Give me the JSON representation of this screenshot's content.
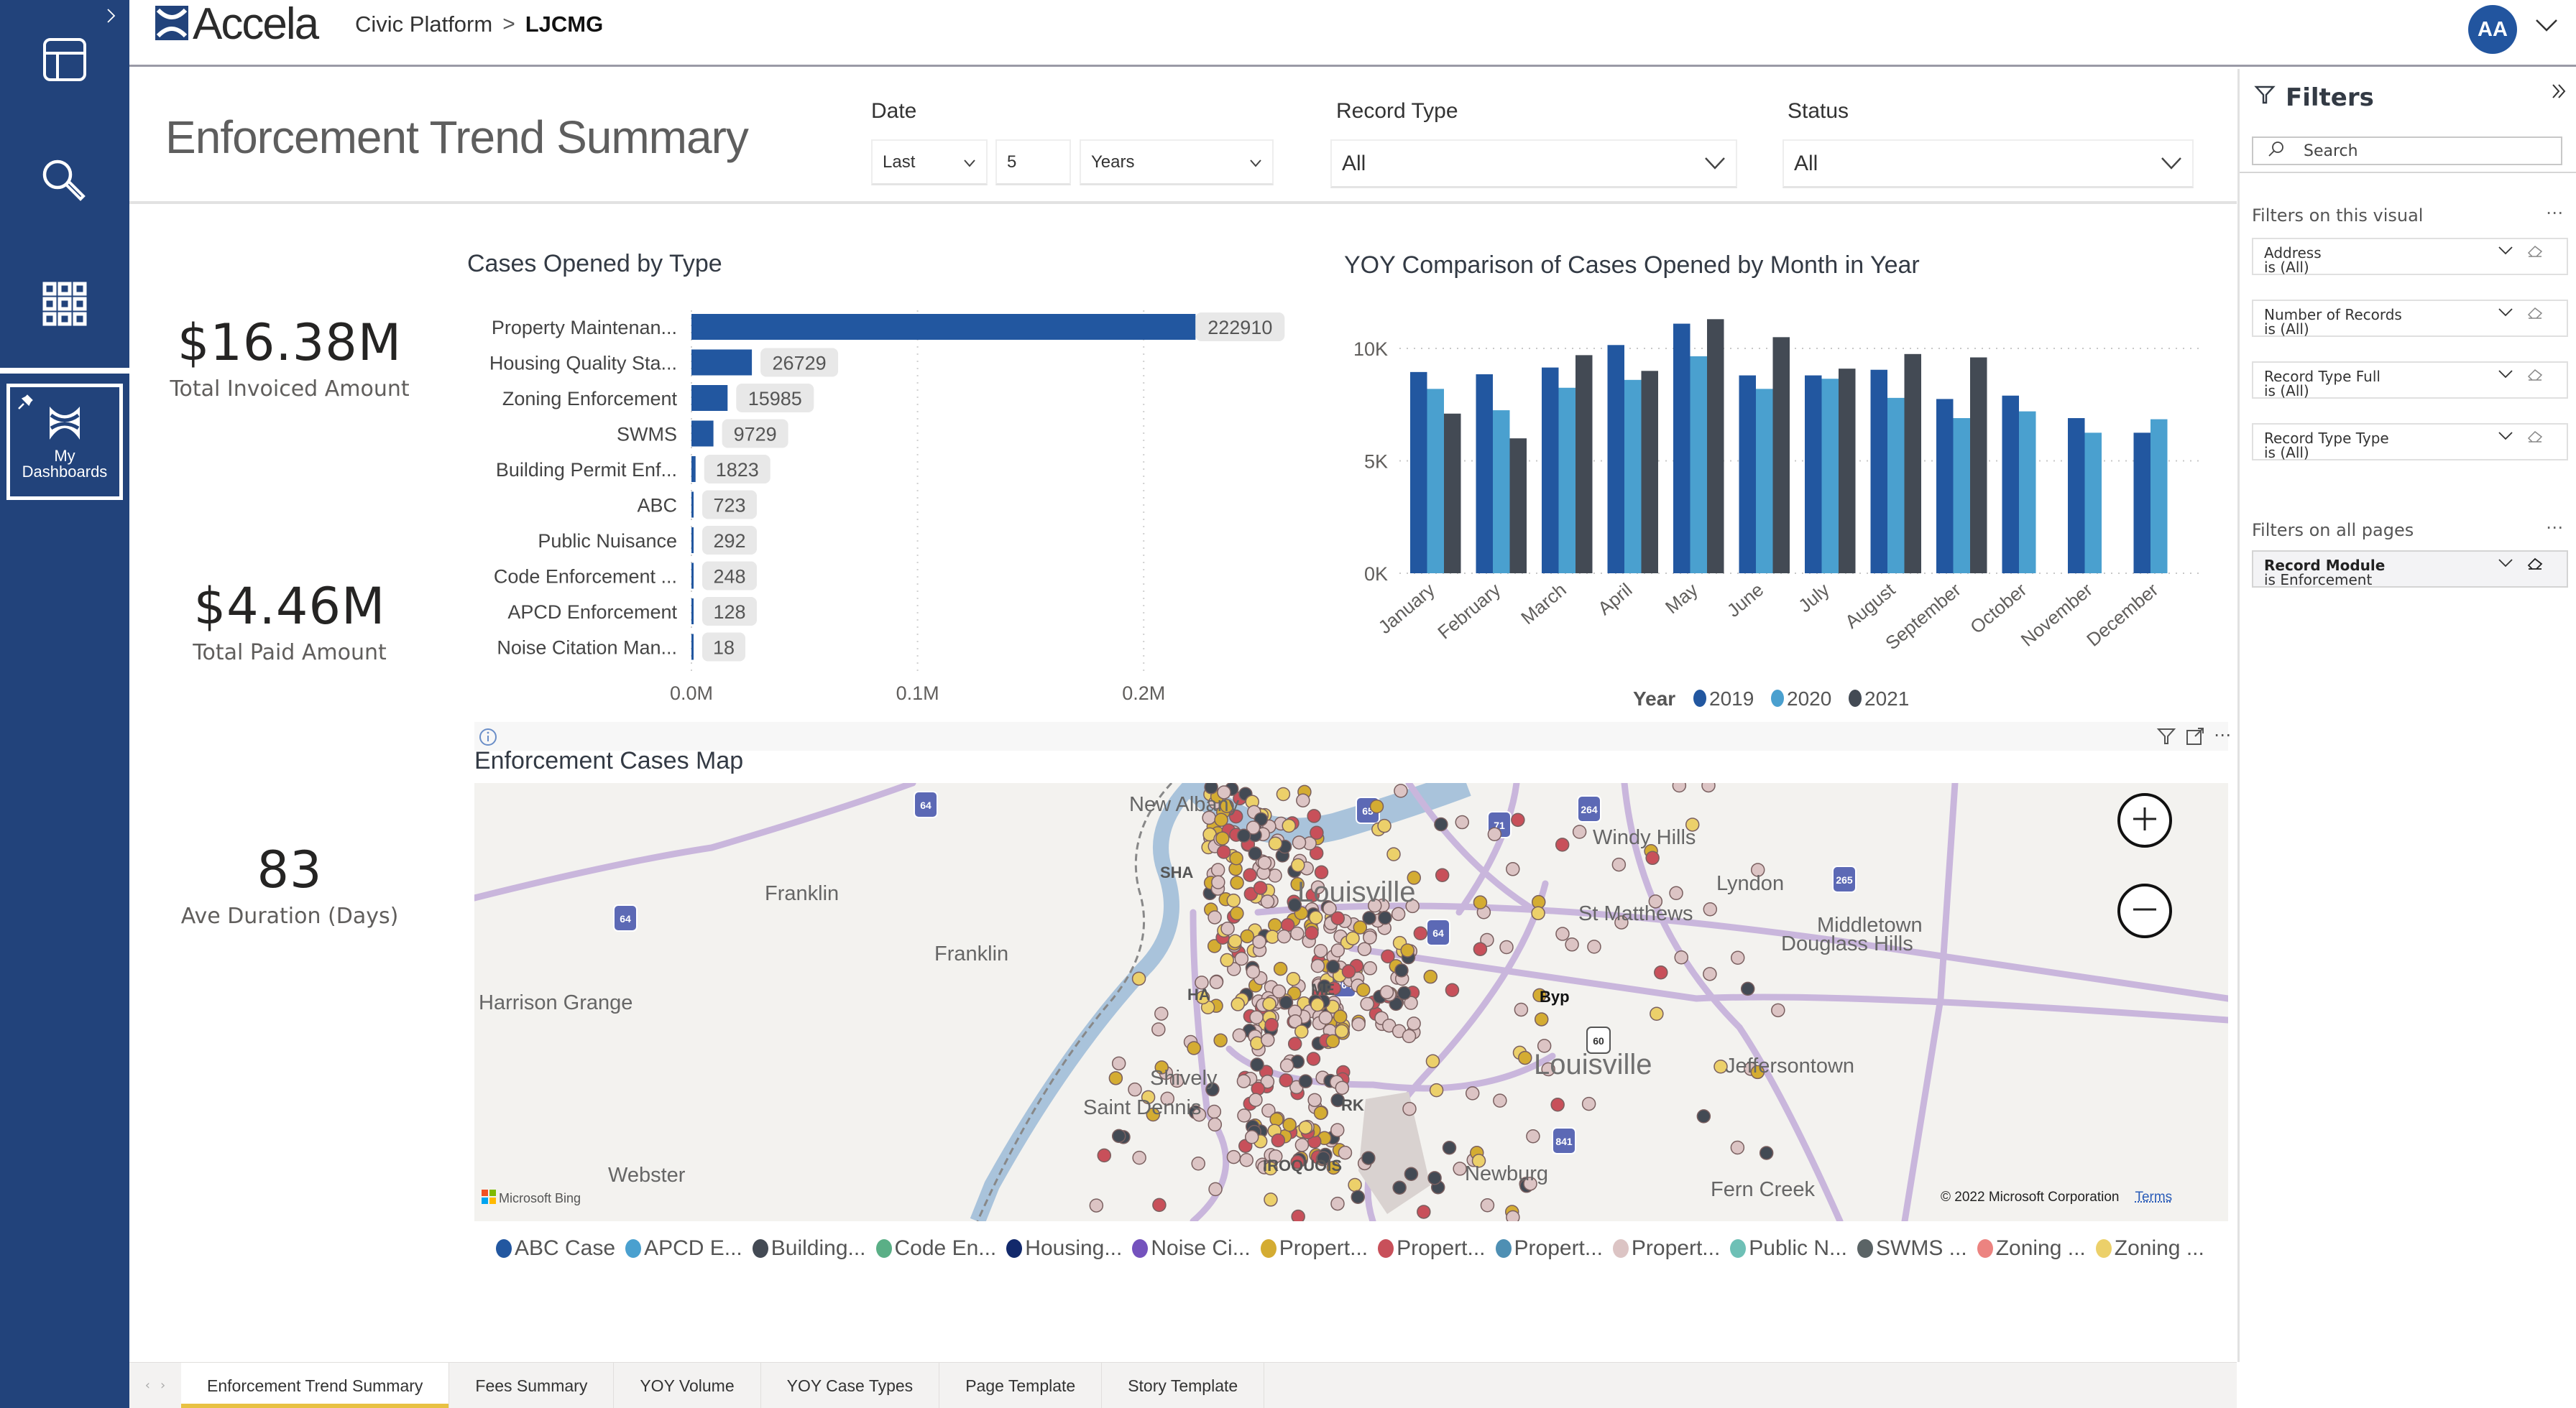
{
  "app": {
    "brand": "Accela",
    "breadcrumb": [
      "Civic Platform",
      "LJCMG"
    ],
    "breadcrumb_separator": ">",
    "user_initials": "AA",
    "brand_color": "#22437b"
  },
  "sidebar": {
    "items": [
      {
        "icon": "layout-icon",
        "label": "Layout"
      },
      {
        "icon": "search-icon",
        "label": "Search"
      },
      {
        "icon": "apps-grid-icon",
        "label": "Apps"
      }
    ],
    "dashboards_label_line1": "My",
    "dashboards_label_line2": "Dashboards"
  },
  "header": {
    "title": "Enforcement Trend Summary",
    "date": {
      "label": "Date",
      "relative": "Last",
      "count": "5",
      "unit": "Years"
    },
    "record_type": {
      "label": "Record Type",
      "value": "All"
    },
    "status": {
      "label": "Status",
      "value": "All"
    }
  },
  "kpis": [
    {
      "value": "$16.38M",
      "label": "Total Invoiced Amount"
    },
    {
      "value": "$4.46M",
      "label": "Total Paid Amount"
    },
    {
      "value": "83",
      "label": "Ave Duration (Days)"
    }
  ],
  "chart_data": [
    {
      "type": "bar",
      "orientation": "horizontal",
      "title": "Cases Opened by Type",
      "categories": [
        "Property Maintenan...",
        "Housing Quality Sta...",
        "Zoning Enforcement",
        "SWMS",
        "Building Permit Enf...",
        "ABC",
        "Public Nuisance",
        "Code Enforcement ...",
        "APCD Enforcement",
        "Noise Citation Man..."
      ],
      "values": [
        222910,
        26729,
        15985,
        9729,
        1823,
        723,
        292,
        248,
        128,
        18
      ],
      "xlim": [
        0,
        260000
      ],
      "xticks": [
        0,
        100000,
        200000
      ],
      "xtick_labels": [
        "0.0M",
        "0.1M",
        "0.2M"
      ],
      "grid": true,
      "color": "#2257a0"
    },
    {
      "type": "bar",
      "orientation": "vertical",
      "title": "YOY Comparison of Cases Opened by Month in Year",
      "categories": [
        "January",
        "February",
        "March",
        "April",
        "May",
        "June",
        "July",
        "August",
        "September",
        "October",
        "November",
        "December"
      ],
      "series": [
        {
          "name": "2019",
          "color": "#2257a0",
          "values": [
            8950,
            8850,
            9150,
            10150,
            11100,
            8800,
            8800,
            9050,
            7750,
            7900,
            6900,
            6250
          ]
        },
        {
          "name": "2020",
          "color": "#4aa0cf",
          "values": [
            8200,
            7250,
            8250,
            8600,
            9650,
            8200,
            8650,
            7800,
            6900,
            7200,
            6250,
            6850
          ]
        },
        {
          "name": "2021",
          "color": "#434a54",
          "values": [
            7100,
            6000,
            9700,
            9000,
            11300,
            10500,
            9100,
            9750,
            9600,
            null,
            null,
            null
          ]
        }
      ],
      "ylim": [
        0,
        12000
      ],
      "yticks": [
        0,
        5000,
        10000
      ],
      "ytick_labels": [
        "0K",
        "5K",
        "10K"
      ],
      "legend_title": "Year",
      "legend_position": "bottom-center",
      "grid": true
    }
  ],
  "map": {
    "title": "Enforcement Cases Map",
    "attribution": "© 2022 Microsoft Corporation",
    "terms_label": "Terms",
    "provider_label": "Microsoft Bing",
    "zoom_in": "+",
    "zoom_out": "−",
    "places": [
      {
        "name": "New Albany",
        "size": "md"
      },
      {
        "name": "Louisville",
        "size": "big"
      },
      {
        "name": "Louisville",
        "size": "big"
      },
      {
        "name": "Windy Hills",
        "size": "md"
      },
      {
        "name": "Lyndon",
        "size": "md"
      },
      {
        "name": "St Matthews",
        "size": "md"
      },
      {
        "name": "Middletown",
        "size": "md"
      },
      {
        "name": "Douglass Hills",
        "size": "md"
      },
      {
        "name": "Jeffersontown",
        "size": "md"
      },
      {
        "name": "Franklin",
        "size": "md"
      },
      {
        "name": "Franklin",
        "size": "md"
      },
      {
        "name": "Harrison Grange",
        "size": "md"
      },
      {
        "name": "Shively",
        "size": "md"
      },
      {
        "name": "Saint Dennis",
        "size": "md"
      },
      {
        "name": "Webster",
        "size": "md"
      },
      {
        "name": "Newburg",
        "size": "md"
      },
      {
        "name": "Fern Creek",
        "size": "md"
      },
      {
        "name": "Byp",
        "size": "sm"
      },
      {
        "name": "IROQUOIS",
        "size": "sm"
      },
      {
        "name": "SHA",
        "size": "sm"
      },
      {
        "name": "HA",
        "size": "sm"
      },
      {
        "name": "ME",
        "size": "sm"
      },
      {
        "name": "RK",
        "size": "sm"
      }
    ],
    "highways": [
      "64",
      "65",
      "71",
      "264",
      "265",
      "64",
      "64",
      "264",
      "60",
      "841"
    ],
    "legend": [
      {
        "label": "ABC Case",
        "color": "#2257a0"
      },
      {
        "label": "APCD E...",
        "color": "#4aa0cf"
      },
      {
        "label": "Building...",
        "color": "#434a54"
      },
      {
        "label": "Code En...",
        "color": "#5aaf86"
      },
      {
        "label": "Housing...",
        "color": "#12296b"
      },
      {
        "label": "Noise Ci...",
        "color": "#7452bd"
      },
      {
        "label": "Propert...",
        "color": "#d4ac32"
      },
      {
        "label": "Propert...",
        "color": "#c8505a"
      },
      {
        "label": "Propert...",
        "color": "#4e8fb3"
      },
      {
        "label": "Propert...",
        "color": "#dcc4c4"
      },
      {
        "label": "Public N...",
        "color": "#6ec0b6"
      },
      {
        "label": "SWMS ...",
        "color": "#5b6466"
      },
      {
        "label": "Zoning ...",
        "color": "#ec8380"
      },
      {
        "label": "Zoning ...",
        "color": "#ecd06a"
      }
    ]
  },
  "filters": {
    "title": "Filters",
    "search_placeholder": "Search",
    "visual_section": "Filters on this visual",
    "visual_filters": [
      {
        "name": "Address",
        "value": "is (All)"
      },
      {
        "name": "Number of Records",
        "value": "is (All)"
      },
      {
        "name": "Record Type Full",
        "value": "is (All)"
      },
      {
        "name": "Record Type Type",
        "value": "is (All)"
      }
    ],
    "all_pages_section": "Filters on all pages",
    "all_pages_filters": [
      {
        "name": "Record Module",
        "value": "is Enforcement"
      }
    ]
  },
  "tabs": {
    "items": [
      "Enforcement Trend Summary",
      "Fees Summary",
      "YOY Volume",
      "YOY Case Types",
      "Page Template",
      "Story Template"
    ],
    "active_index": 0
  }
}
